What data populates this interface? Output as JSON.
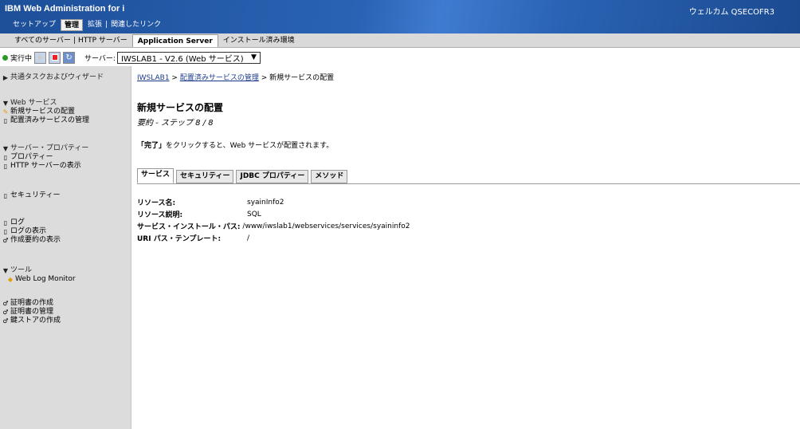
{
  "header": {
    "app_title": "IBM Web Administration for i",
    "welcome": "ウェルカム QSECOFR3",
    "menu": [
      {
        "label": "セットアップ",
        "active": false
      },
      {
        "label": "管理",
        "active": true
      },
      {
        "label": "拡張",
        "active": false
      },
      {
        "label": "関連したリンク",
        "active": false
      }
    ]
  },
  "subtabs": [
    {
      "label": "すべてのサーバー",
      "active": false
    },
    {
      "label": "HTTP サーバー",
      "active": false
    },
    {
      "label": "Application Server",
      "active": true
    },
    {
      "label": "インストール済み環境",
      "active": false
    }
  ],
  "serverbar": {
    "status": "実行中",
    "server_label": "サーバー:",
    "server_value": "IWSLAB1 - V2.6 (Web サービス)"
  },
  "sidebar": {
    "common": "共通タスクおよびウィザード",
    "web_services": "Web サービス",
    "deploy_new": "新規サービスの配置",
    "manage_deployed": "配置済みサービスの管理",
    "server_props": "サーバー・プロパティー",
    "properties": "プロパティー",
    "http_view": "HTTP サーバーの表示",
    "security": "セキュリティー",
    "logs": "ログ",
    "view_logs": "ログの表示",
    "create_summary": "作成要約の表示",
    "tools": "ツール",
    "web_log_monitor": "Web Log Monitor",
    "create_cert": "証明書の作成",
    "manage_cert": "証明書の管理",
    "create_keystore": "鍵ストアの作成"
  },
  "main": {
    "breadcrumb": {
      "item1": "IWSLAB1",
      "sep": " > ",
      "item2": "配置済みサービスの管理",
      "item3": "新規サービスの配置"
    },
    "title": "新規サービスの配置",
    "subtitle": "要約 - ステップ 8 / 8",
    "instruction_bold": "「完了」",
    "instruction_rest": "をクリックすると、Web サービスが配置されます。",
    "tabs": [
      "サービス",
      "セキュリティー",
      "JDBC プロパティー",
      "メソッド"
    ],
    "details": {
      "resource_name_label": "リソース名:",
      "resource_name": "syainInfo2",
      "resource_desc_label": "リソース説明:",
      "resource_desc": "SQL",
      "install_path_label": "サービス・インストール・パス:",
      "install_path": "/www/iwslab1/webservices/services/syaininfo2",
      "uri_label": "URI パス・テンプレート:",
      "uri": "/"
    }
  }
}
